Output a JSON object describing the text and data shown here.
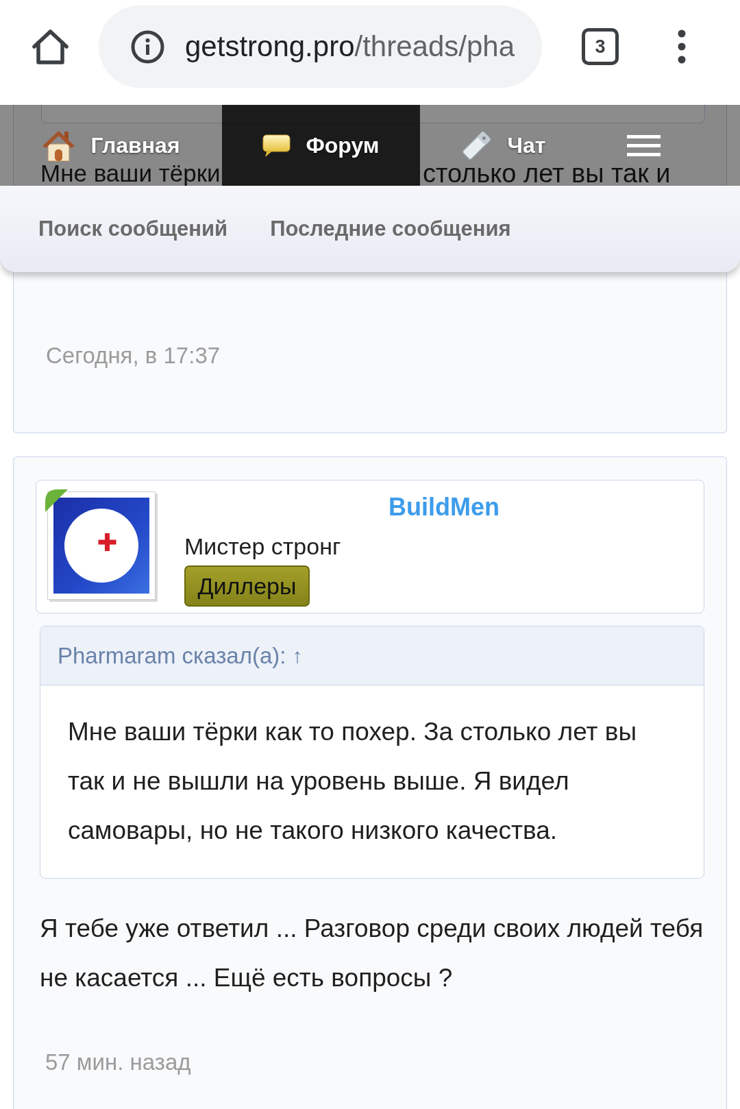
{
  "browser": {
    "url_domain": "getstrong.pro",
    "url_path": "/threads/pha",
    "tab_count": "3"
  },
  "nav": {
    "tabs": [
      {
        "label": "Главная",
        "selected": false
      },
      {
        "label": "Форум",
        "selected": true
      },
      {
        "label": "Чат",
        "selected": false
      }
    ]
  },
  "submenu": {
    "links": [
      "Поиск сообщений",
      "Последние сообщения"
    ]
  },
  "previous_post": {
    "text_fragments": [
      "Мне ваши тёрки",
      "столько лет вы так и"
    ],
    "time": "Сегодня, в 17:37"
  },
  "post": {
    "author": {
      "name": "BuildMen",
      "title": "Мистер стронг",
      "group": "Диллеры"
    },
    "quote": {
      "header": "Pharmaram сказал(а):",
      "link": "↑",
      "text": "Мне ваши тёрки как то похер. За столько лет вы так и не вышли на уровень выше. Я видел самовары, но не такого низкого качества."
    },
    "text": "Я тебе уже ответил ... Разговор среди своих людей тебя не касается ... Ещё есть вопросы ?",
    "time": "57 мин. назад"
  }
}
